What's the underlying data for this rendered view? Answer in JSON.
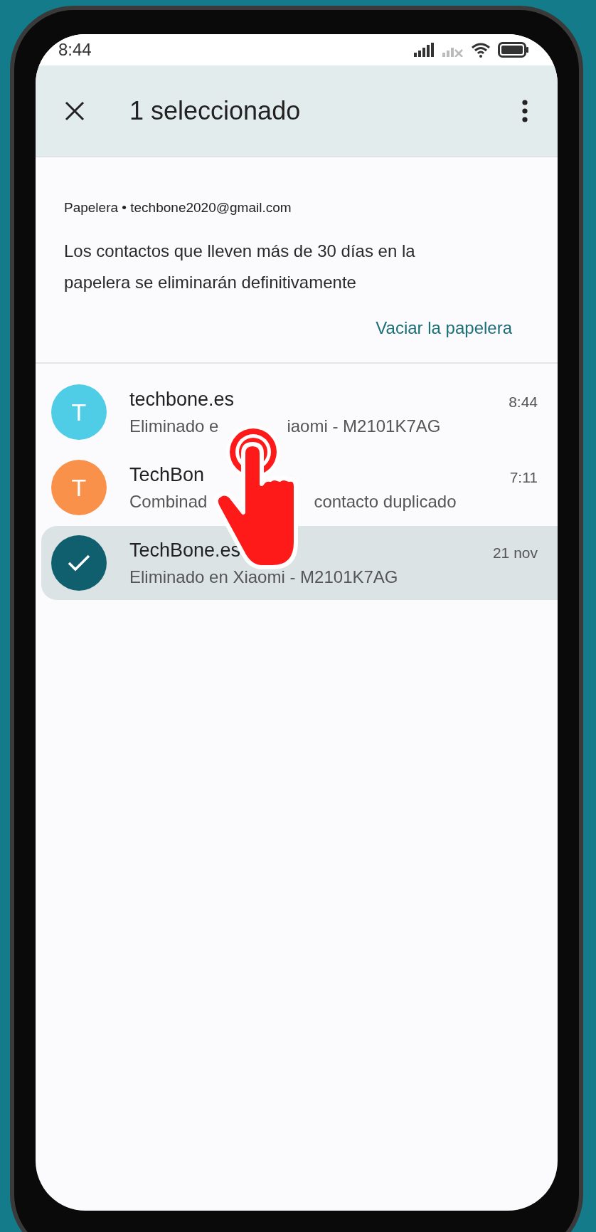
{
  "status_bar": {
    "time": "8:44"
  },
  "app_bar": {
    "title": "1 seleccionado"
  },
  "notice": {
    "account": "Papelera • techbone2020@gmail.com",
    "message": "Los contactos que lleven más de 30 días en la papelera se eliminarán definitivamente",
    "action": "Vaciar la papelera"
  },
  "contacts": [
    {
      "initial": "T",
      "color": "#4fcde6",
      "name_parts": [
        "techbone.es"
      ],
      "detail_parts": [
        "Eliminado e",
        "iaomi - M2101K7AG"
      ],
      "time": "8:44",
      "selected": false
    },
    {
      "initial": "T",
      "color": "#f9914a",
      "name_parts": [
        "TechBon"
      ],
      "detail_parts": [
        "Combinad",
        "contacto duplicado"
      ],
      "time": "7:11",
      "selected": false
    },
    {
      "name_parts": [
        "TechBone.es"
      ],
      "detail_parts": [
        "Eliminado en Xiaomi - M2101K7AG"
      ],
      "time": "21 nov",
      "selected": true
    }
  ]
}
